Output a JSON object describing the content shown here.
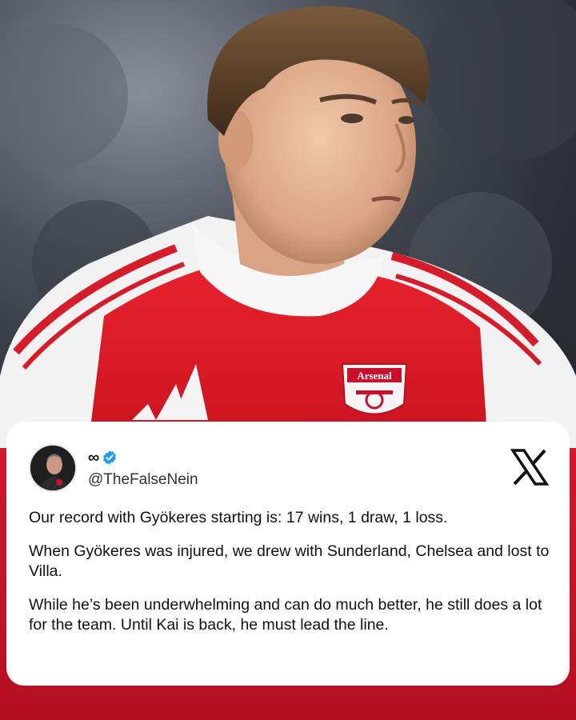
{
  "photo": {
    "description_icon": "player-photo",
    "jersey_crest_text": "Arsenal",
    "colors": {
      "jersey_red": "#e3202f",
      "jersey_white": "#f3f3f3",
      "background": "#c8102e"
    }
  },
  "post": {
    "display_name": "∞",
    "handle": "@TheFalseNein",
    "verified": true,
    "platform_icon": "x-logo-icon",
    "paragraphs": [
      "Our record with Gyökeres starting is: 17 wins, 1 draw, 1 loss.",
      "When Gyökeres was injured, we drew with Sunderland, Chelsea and lost to Villa.",
      "While he’s been underwhelming and can do much better, he still does a lot for the team. Until Kai is back, he must lead the line."
    ]
  }
}
